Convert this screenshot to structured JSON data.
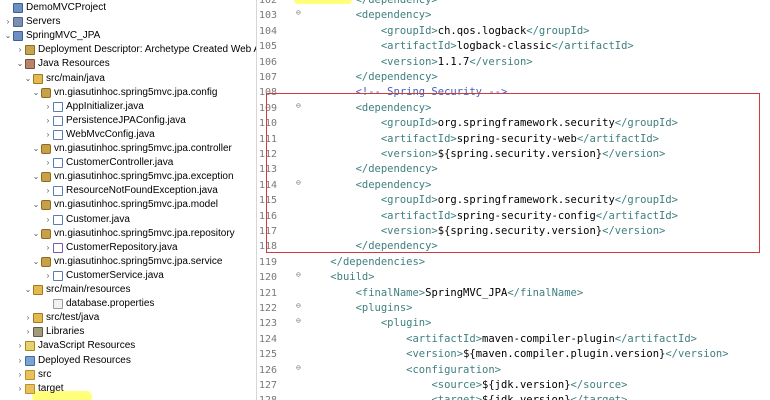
{
  "tree": [
    {
      "label": "DemoMVCProject",
      "icon": "project-icon",
      "twisty": ""
    },
    {
      "label": "Servers",
      "icon": "server-folder-icon",
      "twisty": "›"
    },
    {
      "label": "SpringMVC_JPA",
      "icon": "project-icon",
      "twisty": "⌄"
    },
    {
      "label": "Deployment Descriptor: Archetype Created Web A",
      "icon": "deployment-descriptor-icon",
      "twisty": "›"
    },
    {
      "label": "Java Resources",
      "icon": "java-resources-icon",
      "twisty": "⌄"
    },
    {
      "label": "src/main/java",
      "icon": "source-folder-icon",
      "twisty": "⌄"
    },
    {
      "label": "vn.giasutinhoc.spring5mvc.jpa.config",
      "icon": "package-icon",
      "twisty": "⌄"
    },
    {
      "label": "AppInitializer.java",
      "icon": "java-file-icon",
      "twisty": "›"
    },
    {
      "label": "PersistenceJPAConfig.java",
      "icon": "java-file-icon",
      "twisty": "›"
    },
    {
      "label": "WebMvcConfig.java",
      "icon": "java-file-icon",
      "twisty": "›"
    },
    {
      "label": "vn.giasutinhoc.spring5mvc.jpa.controller",
      "icon": "package-icon",
      "twisty": "⌄"
    },
    {
      "label": "CustomerController.java",
      "icon": "java-file-icon",
      "twisty": "›"
    },
    {
      "label": "vn.giasutinhoc.spring5mvc.jpa.exception",
      "icon": "package-icon",
      "twisty": "⌄"
    },
    {
      "label": "ResourceNotFoundException.java",
      "icon": "java-file-icon",
      "twisty": "›"
    },
    {
      "label": "vn.giasutinhoc.spring5mvc.jpa.model",
      "icon": "package-icon",
      "twisty": "⌄"
    },
    {
      "label": "Customer.java",
      "icon": "java-file-icon",
      "twisty": "›"
    },
    {
      "label": "vn.giasutinhoc.spring5mvc.jpa.repository",
      "icon": "package-icon",
      "twisty": "⌄"
    },
    {
      "label": "CustomerRepository.java",
      "icon": "java-interface-file-icon",
      "twisty": "›"
    },
    {
      "label": "vn.giasutinhoc.spring5mvc.jpa.service",
      "icon": "package-icon",
      "twisty": "⌄"
    },
    {
      "label": "CustomerService.java",
      "icon": "java-file-icon",
      "twisty": "›"
    },
    {
      "label": "src/main/resources",
      "icon": "source-folder-icon",
      "twisty": "⌄"
    },
    {
      "label": "database.properties",
      "icon": "properties-file-icon",
      "twisty": ""
    },
    {
      "label": "src/test/java",
      "icon": "source-folder-icon",
      "twisty": "›"
    },
    {
      "label": "Libraries",
      "icon": "libraries-icon",
      "twisty": "›"
    },
    {
      "label": "JavaScript Resources",
      "icon": "javascript-resources-icon",
      "twisty": "›"
    },
    {
      "label": "Deployed Resources",
      "icon": "deployed-resources-icon",
      "twisty": "›"
    },
    {
      "label": "src",
      "icon": "folder-icon",
      "twisty": "›"
    },
    {
      "label": "target",
      "icon": "folder-icon",
      "twisty": "›"
    }
  ],
  "code": [
    {
      "n": "102",
      "f": "",
      "t": "        </dependency>"
    },
    {
      "n": "103",
      "f": "⊖",
      "t": "        <dependency>"
    },
    {
      "n": "104",
      "f": "",
      "t": "            <groupId>ch.qos.logback</groupId>"
    },
    {
      "n": "105",
      "f": "",
      "t": "            <artifactId>logback-classic</artifactId>"
    },
    {
      "n": "106",
      "f": "",
      "t": "            <version>1.1.7</version>"
    },
    {
      "n": "107",
      "f": "",
      "t": "        </dependency>"
    },
    {
      "n": "108",
      "f": "",
      "t": "        <!-- Spring Security -->"
    },
    {
      "n": "109",
      "f": "⊖",
      "t": "        <dependency>"
    },
    {
      "n": "110",
      "f": "",
      "t": "            <groupId>org.springframework.security</groupId>"
    },
    {
      "n": "111",
      "f": "",
      "t": "            <artifactId>spring-security-web</artifactId>"
    },
    {
      "n": "112",
      "f": "",
      "t": "            <version>${spring.security.version}</version>"
    },
    {
      "n": "113",
      "f": "",
      "t": "        </dependency>"
    },
    {
      "n": "114",
      "f": "⊖",
      "t": "        <dependency>"
    },
    {
      "n": "115",
      "f": "",
      "t": "            <groupId>org.springframework.security</groupId>"
    },
    {
      "n": "116",
      "f": "",
      "t": "            <artifactId>spring-security-config</artifactId>"
    },
    {
      "n": "117",
      "f": "",
      "t": "            <version>${spring.security.version}</version>"
    },
    {
      "n": "118",
      "f": "",
      "t": "        </dependency>"
    },
    {
      "n": "119",
      "f": "",
      "t": "    </dependencies>"
    },
    {
      "n": "120",
      "f": "⊖",
      "t": "    <build>"
    },
    {
      "n": "121",
      "f": "",
      "t": "        <finalName>SpringMVC_JPA</finalName>"
    },
    {
      "n": "122",
      "f": "⊖",
      "t": "        <plugins>"
    },
    {
      "n": "123",
      "f": "⊖",
      "t": "            <plugin>"
    },
    {
      "n": "124",
      "f": "",
      "t": "                <artifactId>maven-compiler-plugin</artifactId>"
    },
    {
      "n": "125",
      "f": "",
      "t": "                <version>${maven.compiler.plugin.version}</version>"
    },
    {
      "n": "126",
      "f": "⊖",
      "t": "                <configuration>"
    },
    {
      "n": "127",
      "f": "",
      "t": "                    <source>${jdk.version}</source>"
    },
    {
      "n": "128",
      "f": "",
      "t": "                    <target>${jdk.version}</target>"
    }
  ],
  "colors": {
    "tag": "#3f7f7f",
    "comment": "#3f5fbf",
    "text": "#000000",
    "highlight_box": "#d43a3a",
    "marker": "#ffff7a"
  }
}
